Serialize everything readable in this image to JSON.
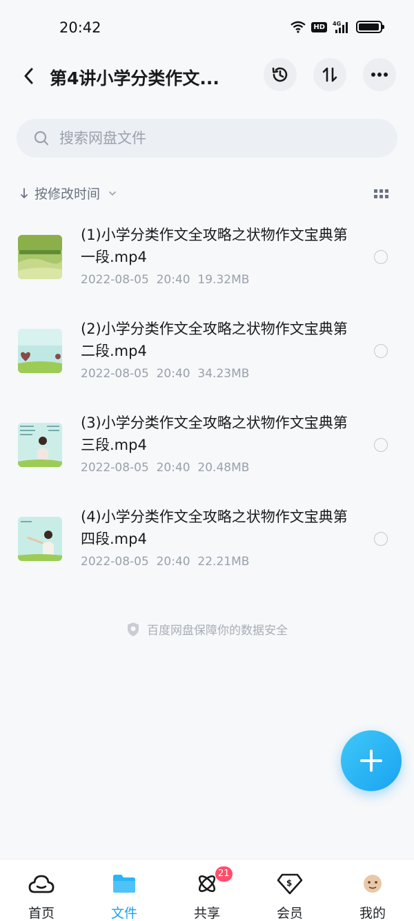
{
  "status_bar": {
    "time": "20:42",
    "network": "4G",
    "hd": "HD"
  },
  "header": {
    "title": "第4讲小学分类作文..."
  },
  "search": {
    "placeholder": "搜索网盘文件"
  },
  "sort": {
    "label": "按修改时间"
  },
  "files": [
    {
      "name": "(1)小学分类作文全攻略之状物作文宝典第一段.mp4",
      "date": "2022-08-05",
      "time": "20:40",
      "size": "19.32MB"
    },
    {
      "name": "(2)小学分类作文全攻略之状物作文宝典第二段.mp4",
      "date": "2022-08-05",
      "time": "20:40",
      "size": "34.23MB"
    },
    {
      "name": "(3)小学分类作文全攻略之状物作文宝典第三段.mp4",
      "date": "2022-08-05",
      "time": "20:40",
      "size": "20.48MB"
    },
    {
      "name": "(4)小学分类作文全攻略之状物作文宝典第四段.mp4",
      "date": "2022-08-05",
      "time": "20:40",
      "size": "22.21MB"
    }
  ],
  "security_note": "百度网盘保障你的数据安全",
  "nav": [
    {
      "label": "首页",
      "icon": "cloud-icon",
      "active": false
    },
    {
      "label": "文件",
      "icon": "folder-icon",
      "active": true
    },
    {
      "label": "共享",
      "icon": "atom-icon",
      "active": false,
      "badge": "21"
    },
    {
      "label": "会员",
      "icon": "vip-diamond-icon",
      "active": false
    },
    {
      "label": "我的",
      "icon": "profile-icon",
      "active": false
    }
  ],
  "colors": {
    "accent": "#1ba1ef",
    "badge": "#ff4d6a",
    "background": "#f6f8fa"
  }
}
